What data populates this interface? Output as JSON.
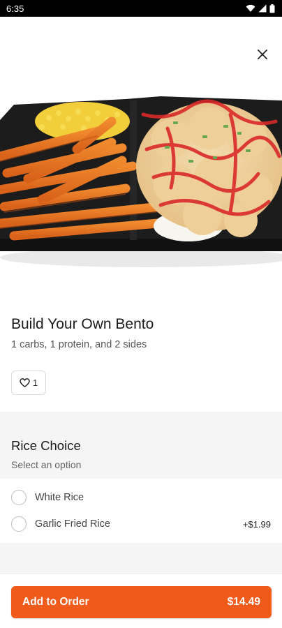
{
  "status_bar": {
    "time": "6:35",
    "icons": [
      "wifi-icon",
      "signal-icon",
      "battery-icon"
    ]
  },
  "hero": {
    "image_subject": "bento box with sweet potato fries, corn, rice and chicken",
    "close_icon": "close-icon"
  },
  "item": {
    "title": "Build Your Own Bento",
    "description": "1 carbs, 1 protein, and 2 sides",
    "likes": "1",
    "like_icon": "heart-icon"
  },
  "section": {
    "title": "Rice Choice",
    "subtitle": "Select an option",
    "options": [
      {
        "label": "White Rice",
        "price": ""
      },
      {
        "label": "Garlic Fried Rice",
        "price": "+$1.99"
      }
    ]
  },
  "footer": {
    "button_label": "Add to Order",
    "total": "$14.49"
  },
  "colors": {
    "accent": "#f05a1a",
    "section_bg": "#f5f5f5"
  }
}
